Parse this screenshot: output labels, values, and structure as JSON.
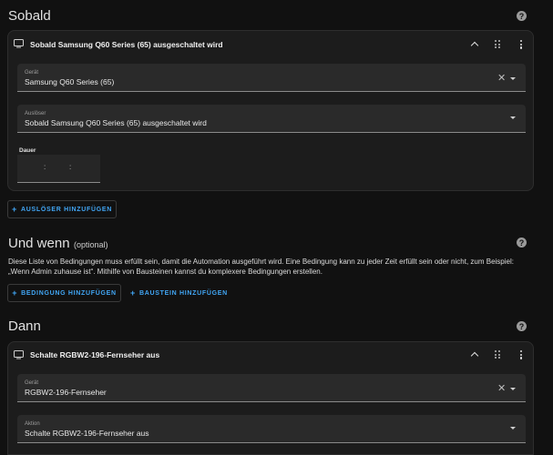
{
  "sobald": {
    "title": "Sobald",
    "card_title": "Sobald Samsung Q60 Series (65) ausgeschaltet wird",
    "device_label": "Gerät",
    "device_value": "Samsung Q60 Series (65)",
    "trigger_label": "Auslöser",
    "trigger_value": "Sobald Samsung Q60 Series (65) ausgeschaltet wird",
    "duration_label": "Dauer",
    "duration_sep1": ":",
    "duration_sep2": ":",
    "add_button": "AUSLÖSER HINZUFÜGEN"
  },
  "und_wenn": {
    "title": "Und wenn",
    "optional": "(optional)",
    "description": "Diese Liste von Bedingungen muss erfüllt sein, damit die Automation ausgeführt wird. Eine Bedingung kann zu jeder Zeit erfüllt sein oder nicht, zum Beispiel: „Wenn Admin zuhause ist“. Mithilfe von Bausteinen kannst du komplexere Bedingungen erstellen.",
    "add_condition": "BEDINGUNG HINZUFÜGEN",
    "add_block": "BAUSTEIN HINZUFÜGEN"
  },
  "dann": {
    "title": "Dann",
    "card_title": "Schalte RGBW2-196-Fernseher aus",
    "device_label": "Gerät",
    "device_value": "RGBW2-196-Fernseher",
    "action_label": "Aktion",
    "action_value": "Schalte RGBW2-196-Fernseher aus"
  },
  "icons": {
    "help": "?",
    "plus": "+",
    "clear": "✕"
  },
  "colors": {
    "background": "#111111",
    "card": "#1c1c1c",
    "field": "#2a2a2a",
    "accent": "#41a6f5"
  }
}
